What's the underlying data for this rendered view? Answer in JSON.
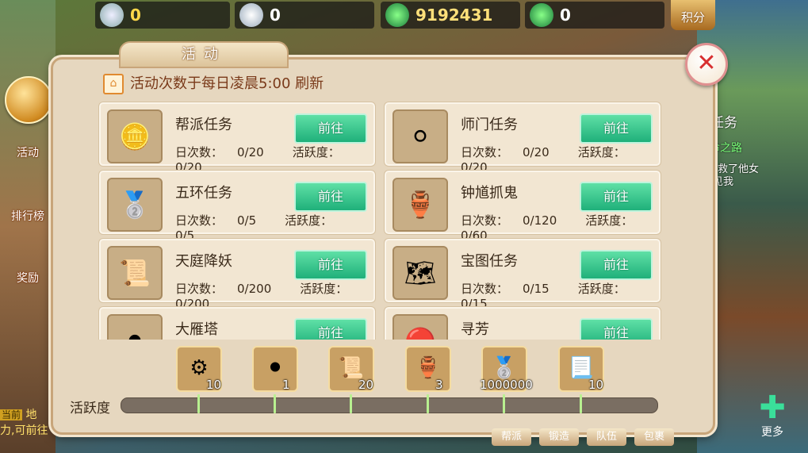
{
  "currencies": [
    {
      "icon": "gong-coin-icon",
      "value": "0",
      "color": "#ffd84a"
    },
    {
      "icon": "silver-ingot-plus-icon",
      "value": "0",
      "color": "#ffffff"
    },
    {
      "icon": "jade-plus-icon",
      "value": "9192431",
      "color": "#ffe07a"
    },
    {
      "icon": "jade-lock-icon",
      "value": "0",
      "color": "#ffffff"
    }
  ],
  "score_button": "积分",
  "panel": {
    "tab_title": "活动",
    "notice": "活动次数于每日凌晨5:00 刷新",
    "go_label": "前往",
    "daily_label": "日次数：",
    "activity_label": "活跃度："
  },
  "activities": [
    {
      "title": "帮派任务",
      "icon": "gang-token-icon",
      "daily": "0/20",
      "activity": "0/20",
      "emoji": "🪙"
    },
    {
      "title": "师门任务",
      "icon": "silver-coin-icon",
      "daily": "0/20",
      "activity": "0/20",
      "emoji": "⚪"
    },
    {
      "title": "五环任务",
      "icon": "silver-ingots-icon",
      "daily": "0/5",
      "activity": "0/5",
      "emoji": "🥈"
    },
    {
      "title": "钟馗抓鬼",
      "icon": "jade-vase-icon",
      "daily": "0/120",
      "activity": "0/60",
      "emoji": "🏺"
    },
    {
      "title": "天庭降妖",
      "icon": "scroll-book-icon",
      "daily": "0/200",
      "activity": "0/200",
      "emoji": "📜"
    },
    {
      "title": "宝图任务",
      "icon": "treasure-map-icon",
      "daily": "0/15",
      "activity": "0/15",
      "emoji": "🗺"
    },
    {
      "title": "大雁塔",
      "icon": "iron-ore-icon",
      "daily": "",
      "activity": "",
      "emoji": "⚫"
    },
    {
      "title": "寻芳",
      "icon": "red-gem-icon",
      "daily": "",
      "activity": "",
      "emoji": "🔴"
    }
  ],
  "activity_bar": {
    "label": "活跃度",
    "progress": 0,
    "rewards": [
      {
        "icon": "green-gear-icon",
        "count": "10",
        "emoji": "⚙"
      },
      {
        "icon": "iron-ore-icon",
        "count": "1",
        "emoji": "⚫"
      },
      {
        "icon": "scroll-book-icon",
        "count": "20",
        "emoji": "📜"
      },
      {
        "icon": "jade-vase-icon",
        "count": "3",
        "emoji": "🏺"
      },
      {
        "icon": "silver-ingots-icon",
        "count": "1000000",
        "emoji": "🥈"
      },
      {
        "icon": "golden-scroll-icon",
        "count": "10",
        "emoji": "📃"
      }
    ]
  },
  "side_menu": [
    "活动",
    "排行榜",
    "奖励"
  ],
  "right_panel": {
    "tab": "任务",
    "quest": "天命之路",
    "line1": "校尉新闻我救了他女",
    "line2": "非常想见我"
  },
  "bottom_tabs": [
    "帮派",
    "锻造",
    "队伍",
    "包裹"
  ],
  "more_label": "更多",
  "bottom_left": {
    "badge": "当前",
    "text1": "地",
    "text2": "力,可前往"
  }
}
